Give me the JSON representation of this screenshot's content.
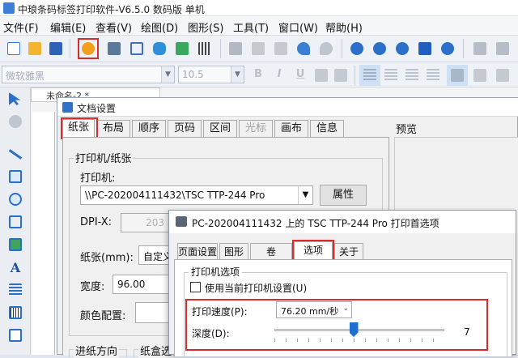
{
  "app": {
    "title": "中琅条码标签打印软件-V6.5.0 数码版 单机"
  },
  "menu": [
    "文件(F)",
    "编辑(E)",
    "查看(V)",
    "绘图(D)",
    "图形(S)",
    "工具(T)",
    "窗口(W)",
    "帮助(H)"
  ],
  "format": {
    "font": "微软雅黑",
    "size": "10.5",
    "bold": "B",
    "italic": "I",
    "underline": "U"
  },
  "document": {
    "tab_title": "未命名-2 *"
  },
  "doc_settings": {
    "title": "文档设置",
    "tabs": [
      "纸张",
      "布局",
      "顺序",
      "页码",
      "区间",
      "光标",
      "画布",
      "信息"
    ],
    "preview_label": "预览",
    "group_label": "打印机/纸张",
    "printer_label": "打印机:",
    "printer_value": "\\\\PC-202004111432\\TSC TTP-244 Pro",
    "properties_button": "属性",
    "dpi_label": "DPI-X:",
    "dpi_value": "203",
    "paper_label": "纸张(mm):",
    "paper_value": "自定义",
    "width_label": "宽度:",
    "width_value": "96.00",
    "color_label": "颜色配置:",
    "feed_label": "进纸方向",
    "tray_label": "纸盒选"
  },
  "print_prefs": {
    "title": "PC-202004111432 上的 TSC TTP-244 Pro 打印首选项",
    "tabs": [
      "页面设置",
      "图形",
      "卷",
      "选项",
      "关于"
    ],
    "group_label": "打印机选项",
    "use_current_label": "使用当前打印机设置(U)",
    "speed_label": "打印速度(P):",
    "speed_value": "76.20 mm/秒",
    "darkness_label": "深度(D):",
    "darkness_value": "7",
    "darkness_level": 7,
    "darkness_max": 15
  },
  "colors": {
    "highlight": "#d92b2b",
    "accent": "#1f6fd1"
  }
}
